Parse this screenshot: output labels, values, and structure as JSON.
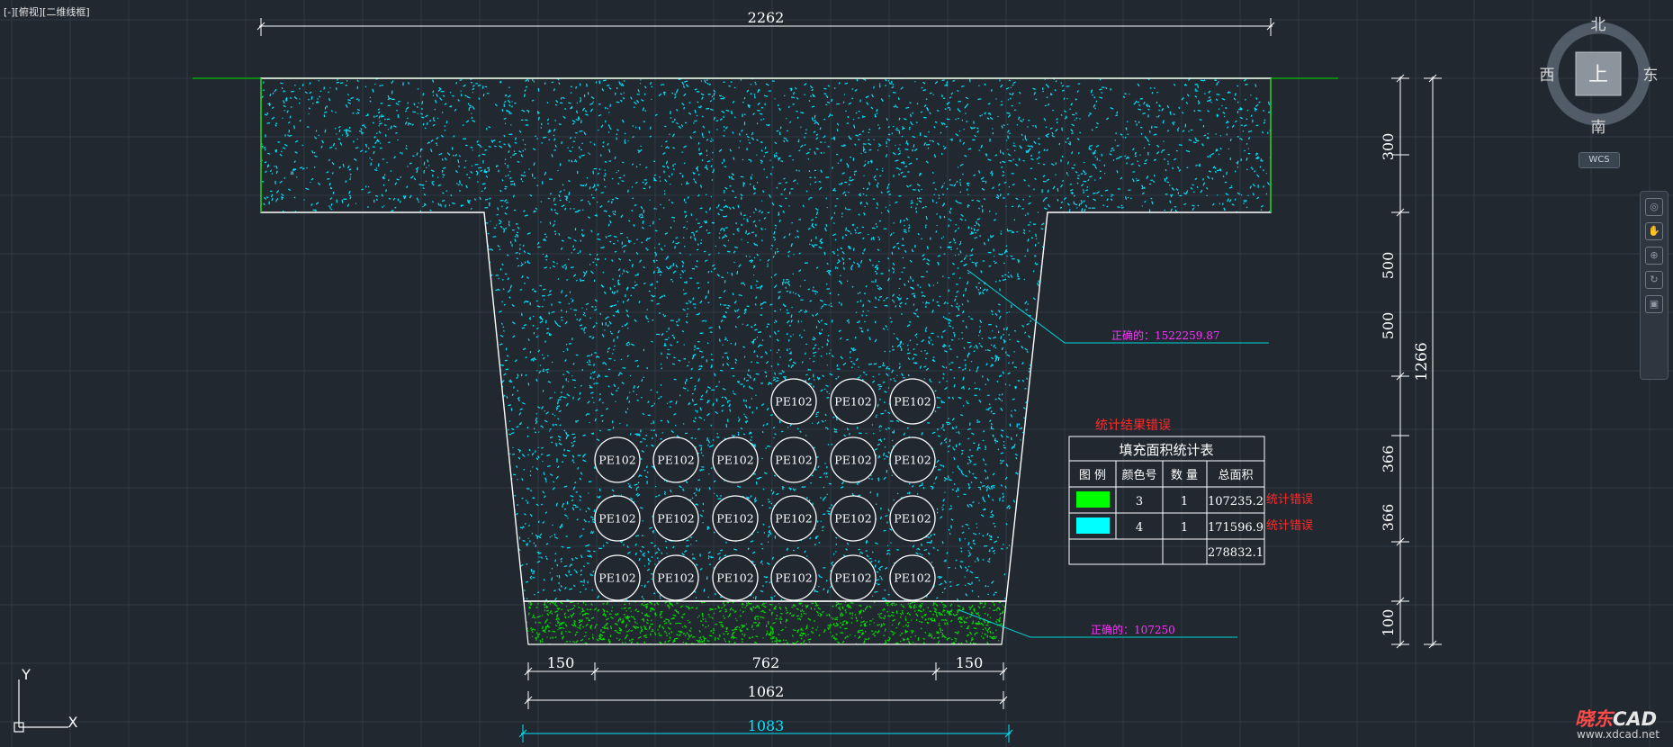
{
  "viewport": {
    "label": "[-][俯视][二维线框]"
  },
  "viewcube": {
    "north": "北",
    "south": "南",
    "west": "西",
    "east": "东",
    "top": "上",
    "wcs": "WCS"
  },
  "ucs": {
    "x": "X",
    "y": "Y"
  },
  "dimensions": {
    "top_width": "2262",
    "bottom_left": "150",
    "bottom_mid": "762",
    "bottom_right": "150",
    "bottom_total": "1062",
    "bottom_outer": "1083",
    "right": [
      "300",
      "500",
      "500",
      "366",
      "366",
      "100"
    ],
    "total_height": "1266"
  },
  "annotations": {
    "correct_top": "正确的：1522259.87",
    "correct_bottom": "正确的：107250",
    "result_error": "统计结果错误"
  },
  "table": {
    "title": "填充面积统计表",
    "headers": [
      "图 例",
      "颜色号",
      "数 量",
      "总面积"
    ],
    "rows": [
      {
        "swatch": "#00ff00",
        "color_no": "3",
        "count": "1",
        "area": "107235.2",
        "note": "统计错误"
      },
      {
        "swatch": "#00ffff",
        "color_no": "4",
        "count": "1",
        "area": "171596.9",
        "note": "统计错误"
      }
    ],
    "total": "278832.1"
  },
  "pipes": {
    "label": "PE102",
    "row1_count": 3,
    "row_count": 6,
    "rows_full": 3
  },
  "colors": {
    "background": "#212830",
    "grid": "#2f3945",
    "outline": "#ffffff",
    "hatch_cyan": "#00e5ff",
    "hatch_green": "#00e000",
    "leader": "#00d6d6",
    "magenta": "#ff33ff",
    "red": "#ff2a2a",
    "cyan_dim": "#00e5ff"
  },
  "watermark": {
    "brand": "晓东",
    "cad": "CAD",
    "url": "www.xdcad.net"
  }
}
